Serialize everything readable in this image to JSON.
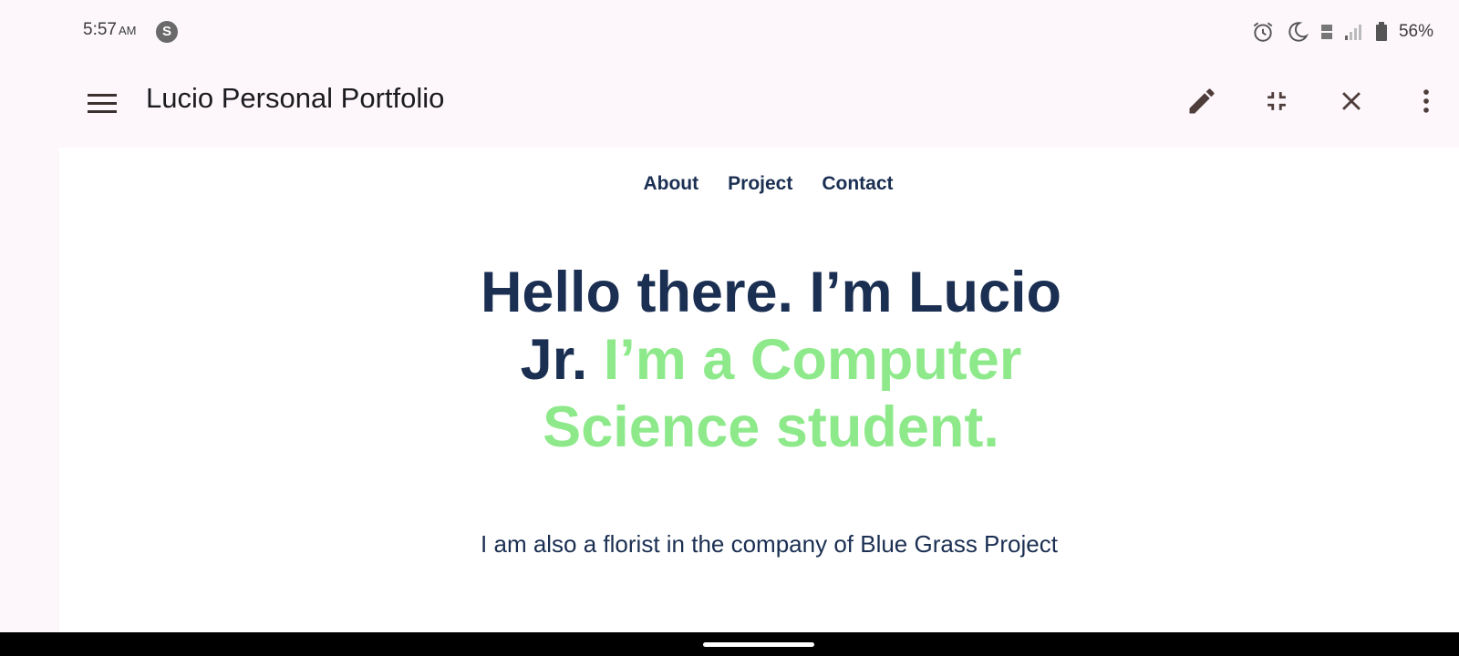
{
  "status_bar": {
    "time": "5:57",
    "ampm": "AM",
    "sync_icon_letter": "S",
    "battery_percent": "56%",
    "icons": [
      "alarm-icon",
      "do-not-disturb-moon-icon",
      "volte-icon",
      "signal-icon",
      "battery-icon"
    ]
  },
  "app_bar": {
    "title": "Lucio Personal Portfolio",
    "icons": [
      "menu-icon",
      "edit-icon",
      "fullscreen-exit-icon",
      "close-icon",
      "more-vert-icon"
    ]
  },
  "site": {
    "nav": [
      "About",
      "Project",
      "Contact"
    ],
    "headline_part1": "Hello there. I’m Lucio Jr.",
    "headline_part2": "I’m a Computer Science student.",
    "subtitle": "I am also a florist in the company of Blue Grass Project"
  },
  "colors": {
    "navy": "#1b2f52",
    "green": "#8ee98b",
    "app_background": "#fdf7fb",
    "icon_brown": "#4e3d3b"
  }
}
